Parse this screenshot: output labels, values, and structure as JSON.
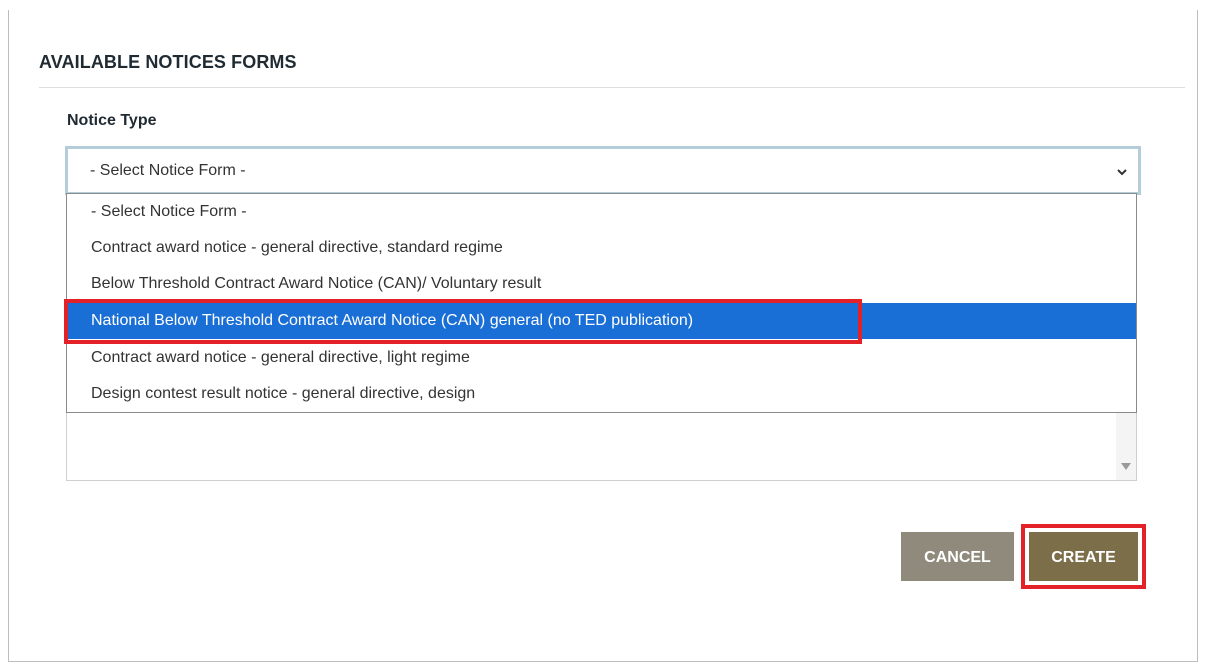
{
  "dialog": {
    "title": "AVAILABLE NOTICES FORMS",
    "field_label": "Notice Type",
    "select": {
      "value": "- Select Notice Form -",
      "options": [
        "- Select Notice Form -",
        "Contract award notice - general directive, standard regime",
        "Below Threshold Contract Award Notice (CAN)/ Voluntary result",
        "National Below Threshold Contract Award Notice (CAN) general (no TED publication)",
        "Contract award notice - general directive, light regime",
        "Design contest result notice - general directive, design"
      ],
      "highlighted_index": 3
    },
    "buttons": {
      "cancel": "CANCEL",
      "create": "CREATE"
    }
  },
  "colors": {
    "selected_option_bg": "#1a6fd6",
    "annotation_red": "#e32128",
    "cancel_bg": "#8f8a7b",
    "create_bg": "#7d6e4a"
  }
}
